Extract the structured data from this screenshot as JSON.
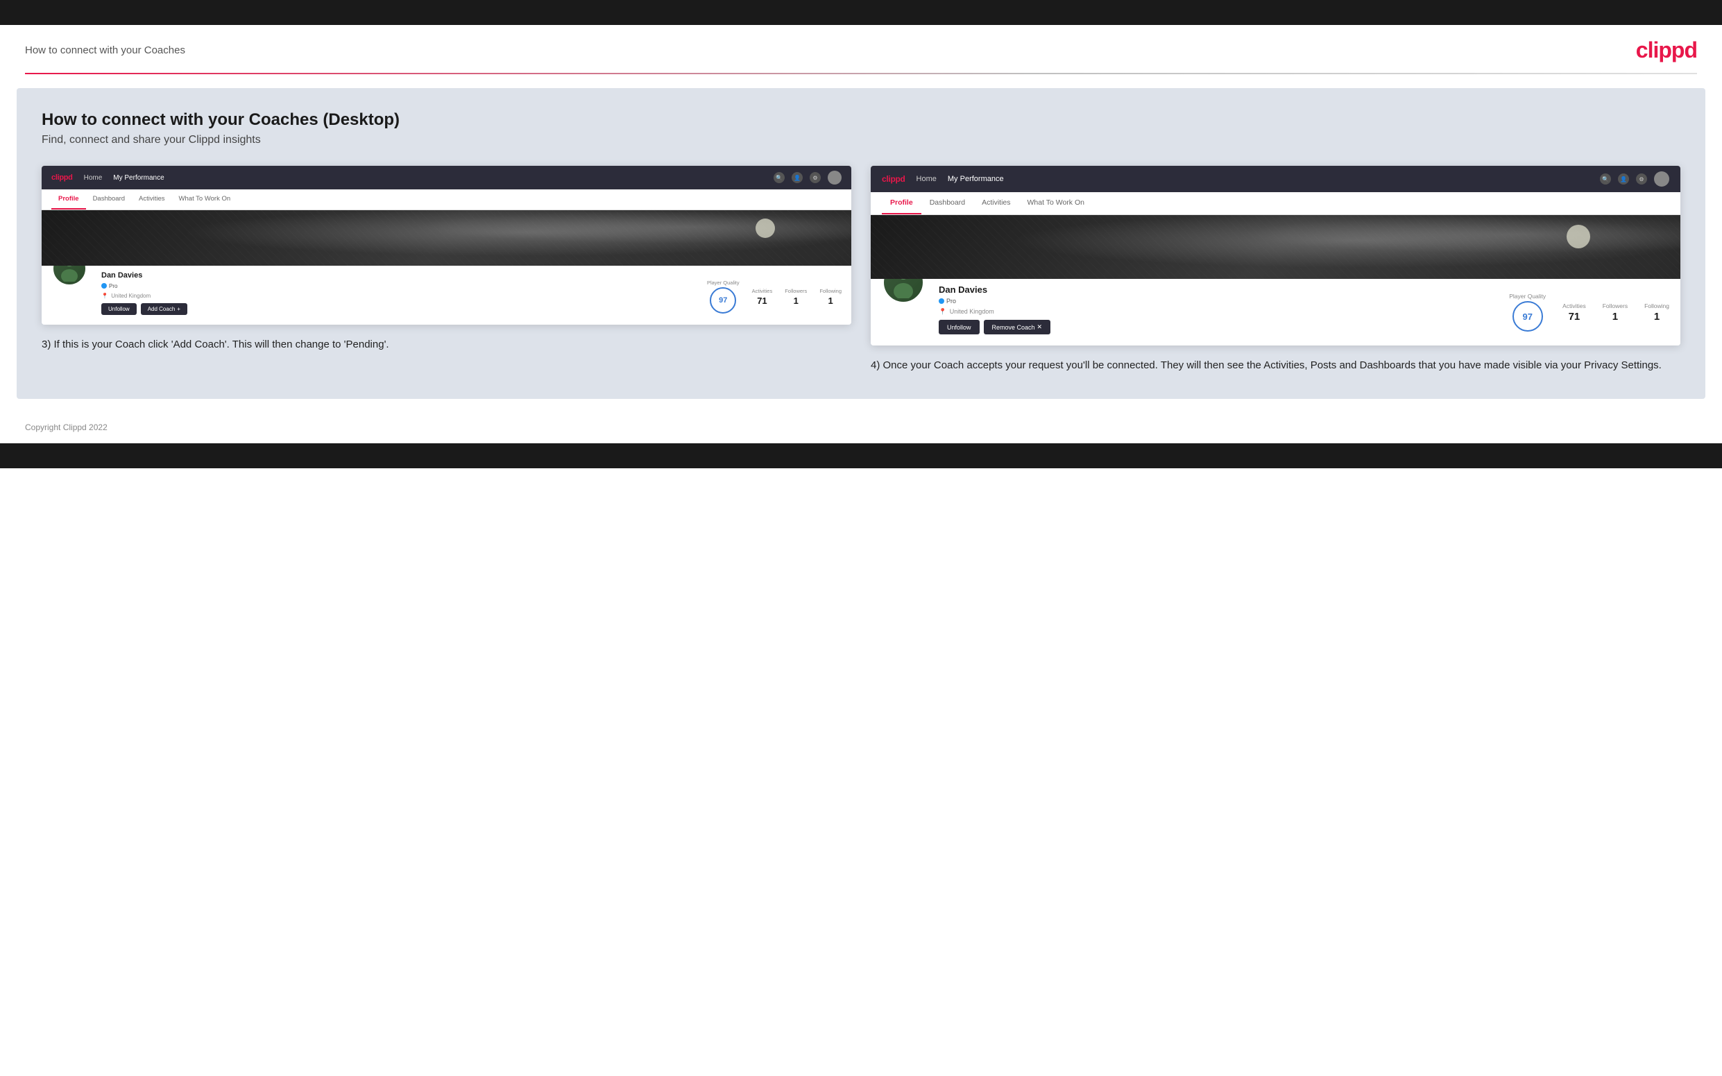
{
  "topBar": {},
  "header": {
    "title": "How to connect with your Coaches",
    "logo": "clippd"
  },
  "main": {
    "title": "How to connect with your Coaches (Desktop)",
    "subtitle": "Find, connect and share your Clippd insights",
    "leftMockup": {
      "nav": {
        "logo": "clippd",
        "items": [
          "Home",
          "My Performance"
        ],
        "icons": [
          "search",
          "user",
          "settings",
          "avatar"
        ]
      },
      "tabs": [
        "Profile",
        "Dashboard",
        "Activities",
        "What To Work On"
      ],
      "activeTab": "Profile",
      "profile": {
        "name": "Dan Davies",
        "badge": "Pro",
        "location": "United Kingdom",
        "stats": {
          "playerQuality": {
            "label": "Player Quality",
            "value": "97"
          },
          "activities": {
            "label": "Activities",
            "value": "71"
          },
          "followers": {
            "label": "Followers",
            "value": "1"
          },
          "following": {
            "label": "Following",
            "value": "1"
          }
        },
        "buttons": {
          "unfollow": "Unfollow",
          "addCoach": "Add Coach",
          "addCoachIcon": "+"
        }
      }
    },
    "rightMockup": {
      "nav": {
        "logo": "clippd",
        "items": [
          "Home",
          "My Performance"
        ],
        "icons": [
          "search",
          "user",
          "settings",
          "avatar"
        ]
      },
      "tabs": [
        "Profile",
        "Dashboard",
        "Activities",
        "What To Work On"
      ],
      "activeTab": "Profile",
      "profile": {
        "name": "Dan Davies",
        "badge": "Pro",
        "location": "United Kingdom",
        "stats": {
          "playerQuality": {
            "label": "Player Quality",
            "value": "97"
          },
          "activities": {
            "label": "Activities",
            "value": "71"
          },
          "followers": {
            "label": "Followers",
            "value": "1"
          },
          "following": {
            "label": "Following",
            "value": "1"
          }
        },
        "buttons": {
          "unfollow": "Unfollow",
          "removeCoach": "Remove Coach",
          "removeCoachIcon": "✕"
        }
      }
    },
    "leftDescription": "3) If this is your Coach click 'Add Coach'. This will then change to 'Pending'.",
    "rightDescription": "4) Once your Coach accepts your request you'll be connected. They will then see the Activities, Posts and Dashboards that you have made visible via your Privacy Settings."
  },
  "footer": {
    "copyright": "Copyright Clippd 2022"
  }
}
